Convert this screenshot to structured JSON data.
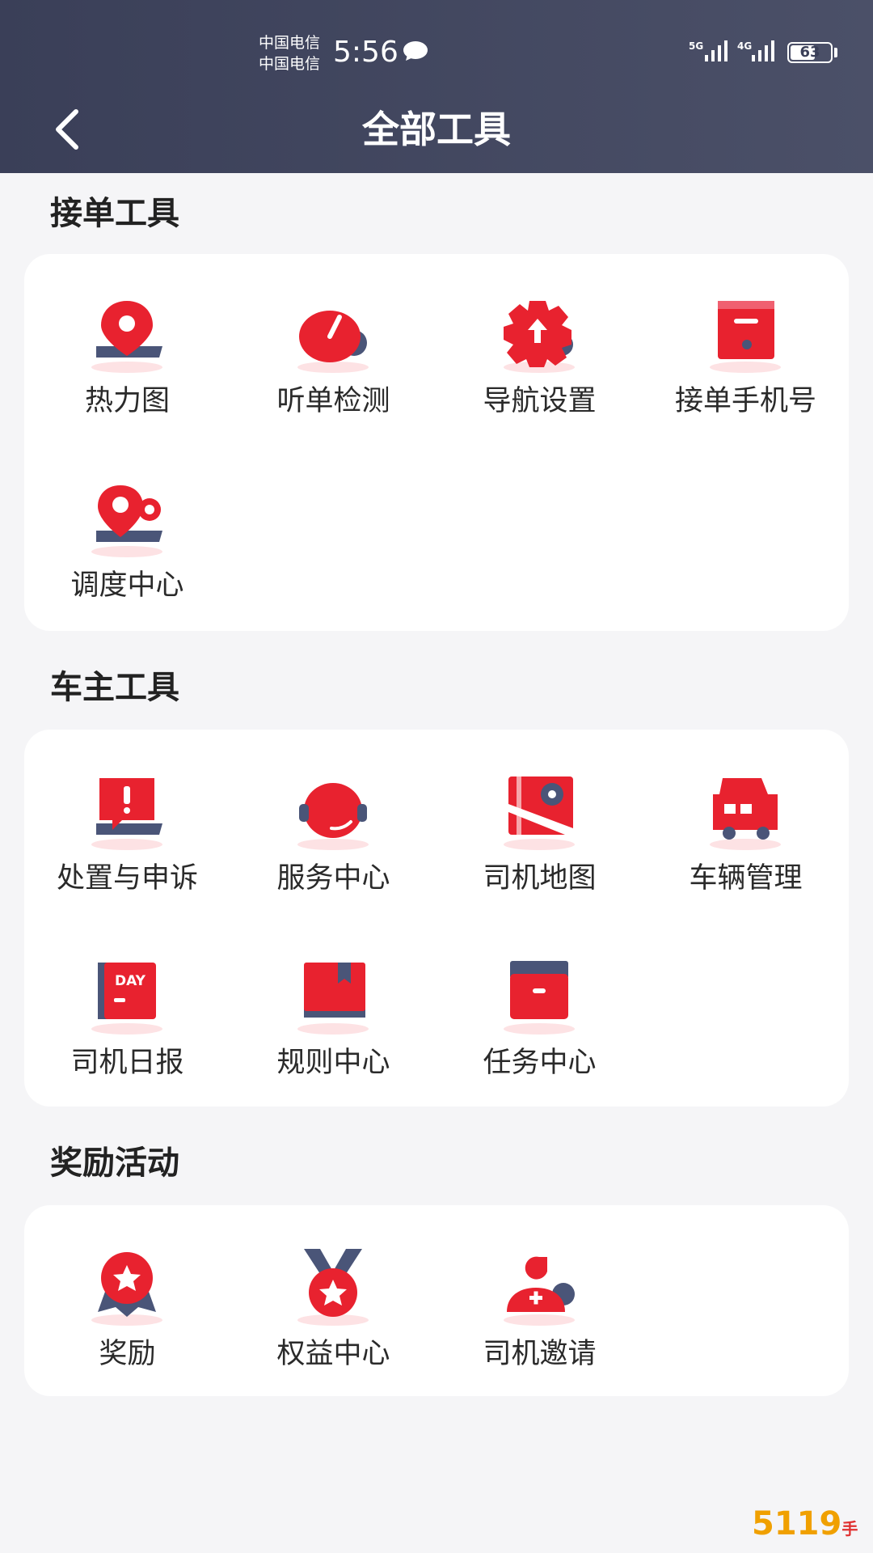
{
  "status_bar": {
    "carrier_1": "中国电信",
    "carrier_2": "中国电信",
    "time": "5:56",
    "network_1": "5G",
    "network_2": "4G",
    "battery": "63",
    "battery_level": 0.63
  },
  "header": {
    "title": "全部工具",
    "back_icon": "chevron-left-icon"
  },
  "sections": [
    {
      "title": "接单工具",
      "tools": [
        {
          "label": "热力图",
          "icon": "heatmap-pin-icon"
        },
        {
          "label": "听单检测",
          "icon": "gauge-icon"
        },
        {
          "label": "导航设置",
          "icon": "gear-arrow-icon"
        },
        {
          "label": "接单手机号",
          "icon": "phone-box-icon"
        },
        {
          "label": "调度中心",
          "icon": "dispatch-pin-icon"
        }
      ]
    },
    {
      "title": "车主工具",
      "tools": [
        {
          "label": "处置与申诉",
          "icon": "alert-chat-icon"
        },
        {
          "label": "服务中心",
          "icon": "headset-icon"
        },
        {
          "label": "司机地图",
          "icon": "map-icon"
        },
        {
          "label": "车辆管理",
          "icon": "car-icon"
        },
        {
          "label": "司机日报",
          "icon": "daily-report-icon",
          "badge": "DAY"
        },
        {
          "label": "规则中心",
          "icon": "rule-book-icon"
        },
        {
          "label": "任务中心",
          "icon": "task-box-icon"
        }
      ]
    },
    {
      "title": "奖励活动",
      "tools": [
        {
          "label": "奖励",
          "icon": "star-badge-icon"
        },
        {
          "label": "权益中心",
          "icon": "medal-icon"
        },
        {
          "label": "司机邀请",
          "icon": "invite-user-icon"
        }
      ]
    }
  ],
  "colors": {
    "header_bg": "#3a3f58",
    "accent_red": "#e8222f",
    "accent_navy": "#4a5578",
    "page_bg": "#f5f5f7"
  },
  "watermark": {
    "main": "5119",
    "sub": "手游网"
  }
}
